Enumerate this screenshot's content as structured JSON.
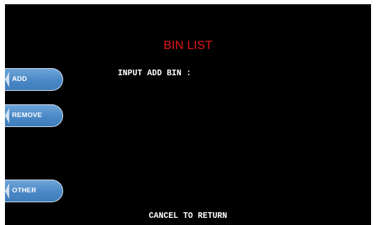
{
  "screen": {
    "title": "BIN LIST",
    "prompt": "INPUT ADD BIN :",
    "footer": "CANCEL TO RETURN"
  },
  "function_keys": {
    "add": "ADD",
    "remove": "REMOVE",
    "other": "OTHER"
  },
  "colors": {
    "background": "#000000",
    "title": "#e8141c",
    "text": "#ffffff",
    "button": "#4a88c6"
  }
}
